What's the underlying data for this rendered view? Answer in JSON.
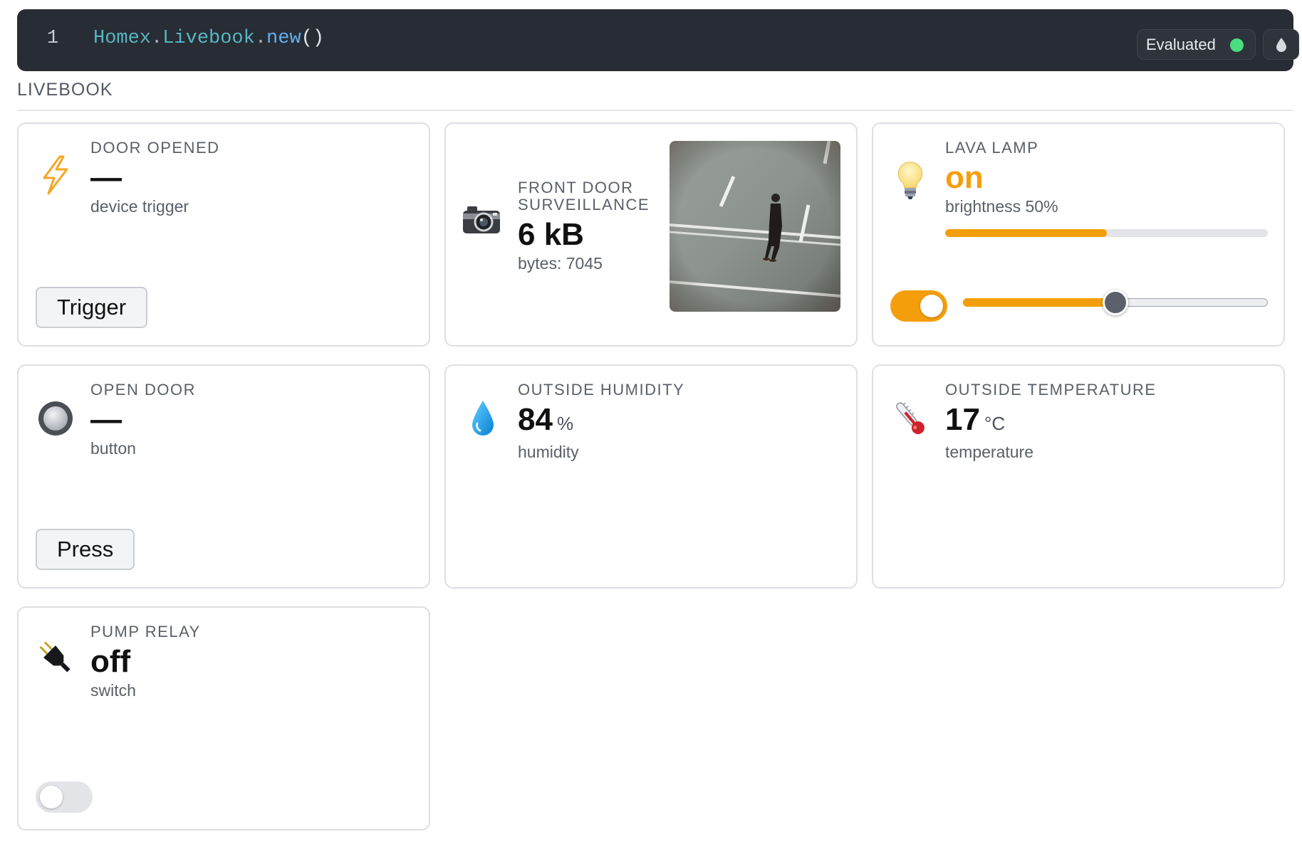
{
  "cell": {
    "line_number": "1",
    "code": {
      "module": "Homex",
      "dot1": ".",
      "submodule": "Livebook",
      "dot2": ".",
      "function": "new",
      "parens": "()"
    },
    "status_label": "Evaluated",
    "status_color": "#4ade80"
  },
  "section": {
    "label": "LIVEBOOK"
  },
  "cards": {
    "door_opened": {
      "icon": "lightning-icon",
      "title": "DOOR OPENED",
      "value": "—",
      "subtitle": "device trigger",
      "button_label": "Trigger"
    },
    "front_door": {
      "icon": "camera-icon",
      "title_line1": "FRONT DOOR",
      "title_line2": "SURVEILLANCE",
      "value": "6 kB",
      "subtitle": "bytes: 7045",
      "image": "surveillance-snapshot"
    },
    "lava_lamp": {
      "icon": "light-bulb-icon",
      "title": "LAVA LAMP",
      "value": "on",
      "value_color": "#f59e0b",
      "subtitle": "brightness 50%",
      "brightness_fraction": 0.5,
      "toggle_on": true,
      "slider_fraction": 0.5
    },
    "open_door": {
      "icon": "round-button-icon",
      "title": "OPEN DOOR",
      "value": "—",
      "subtitle": "button",
      "button_label": "Press"
    },
    "humidity": {
      "icon": "water-drop-icon",
      "title": "OUTSIDE HUMIDITY",
      "value": "84",
      "unit": "%",
      "subtitle": "humidity"
    },
    "temperature": {
      "icon": "thermometer-icon",
      "title": "OUTSIDE TEMPERATURE",
      "value": "17",
      "unit": "°C",
      "subtitle": "temperature"
    },
    "pump_relay": {
      "icon": "electric-plug-icon",
      "title": "PUMP RELAY",
      "value": "off",
      "subtitle": "switch",
      "toggle_on": false
    }
  },
  "colors": {
    "accent": "#f59e0b",
    "cell_background": "#282c34",
    "toggle_off": "#e2e4e8"
  }
}
